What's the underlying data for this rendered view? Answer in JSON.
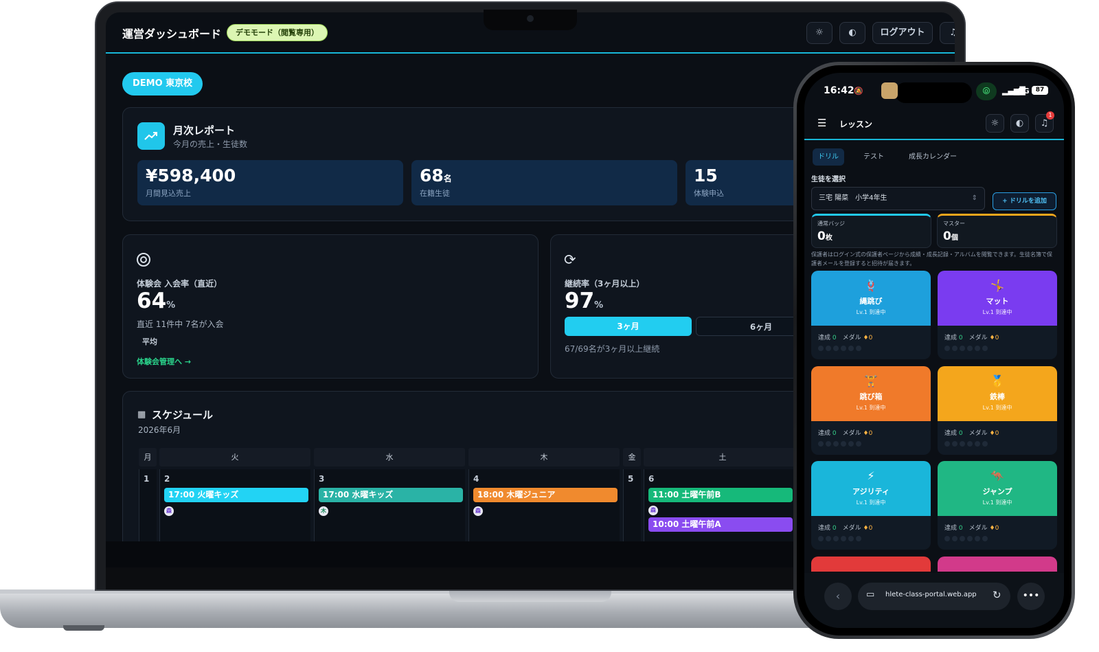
{
  "laptop": {
    "header": {
      "title": "運営ダッシュボード",
      "badge": "デモモード（閲覧専用）",
      "logout": "ログアウト"
    },
    "school": "DEMO 東京校",
    "monthly": {
      "title": "月次レポート",
      "subtitle": "今月の売上・生徒数",
      "stats": [
        {
          "value": "¥598,400",
          "unit": "",
          "label": "月間見込売上"
        },
        {
          "value": "68",
          "unit": "名",
          "label": "在籍生徒"
        },
        {
          "value": "15",
          "unit": "",
          "label": "体験申込"
        }
      ]
    },
    "trial": {
      "label": "体験会 入会率（直近）",
      "value": "64",
      "unit": "%",
      "note": "直近 11件中 7名が入会",
      "avg": "平均",
      "link": "体験会管理へ →"
    },
    "retention": {
      "label": "継続率（3ヶ月以上）",
      "value": "97",
      "unit": "%",
      "tabs": [
        "3ヶ月",
        "6ヶ月"
      ],
      "note": "67/69名が3ヶ月以上継続"
    },
    "schedule": {
      "title": "スケジュール",
      "month": "2026年6月",
      "days": [
        "月",
        "火",
        "水",
        "木",
        "金",
        "土"
      ],
      "dates": [
        "1",
        "2",
        "3",
        "4",
        "5",
        "6"
      ],
      "events": {
        "tue": "17:00 火曜キッズ",
        "wed": "17:00 水曜キッズ",
        "thu": "18:00 木曜ジュニア",
        "sat1": "11:00 土曜午前B",
        "sat2": "10:00 土曜午前A"
      },
      "dot_labels": {
        "tue": "森",
        "wed": "木",
        "thu": "森",
        "sat": "森"
      }
    }
  },
  "phone": {
    "status": {
      "time": "16:42",
      "network": "5G",
      "battery": "87"
    },
    "header": {
      "title": "レッスン",
      "notif_count": "1"
    },
    "tabs": [
      "ドリル",
      "テスト",
      "成長カレンダー"
    ],
    "student_label": "生徒を選択",
    "student_value": "三宅 陽菜　小学4年生",
    "add_drill": "+ ドリルを追加",
    "badges": [
      {
        "label": "通常バッジ",
        "value": "0",
        "unit": "枚"
      },
      {
        "label": "マスター",
        "value": "0",
        "unit": "個"
      }
    ],
    "notice": "保護者はログイン式の保護者ページから成績・成長記録・アルバムを閲覧できます。生徒名簿で保護者メールを登録すると招待が届きます。",
    "tile_stats": {
      "achieved": "達成",
      "medal": "メダル",
      "zero": "0"
    },
    "tiles": [
      {
        "name": "縄跳び",
        "level": "Lv.1 到達中",
        "emoji": "🪢",
        "color": "#1ea0dc"
      },
      {
        "name": "マット",
        "level": "Lv.1 到達中",
        "emoji": "🤸",
        "color": "#7a3cf0"
      },
      {
        "name": "跳び箱",
        "level": "Lv.1 到達中",
        "emoji": "🏋",
        "color": "#f07a2a"
      },
      {
        "name": "鉄棒",
        "level": "Lv.1 到達中",
        "emoji": "🥇",
        "color": "#f4a61c"
      },
      {
        "name": "アジリティ",
        "level": "Lv.1 到達中",
        "emoji": "⚡",
        "color": "#1ab6da"
      },
      {
        "name": "ジャンプ",
        "level": "Lv.1 到達中",
        "emoji": "🦘",
        "color": "#20b784"
      }
    ],
    "url": "hlete-class-portal.web.app"
  }
}
